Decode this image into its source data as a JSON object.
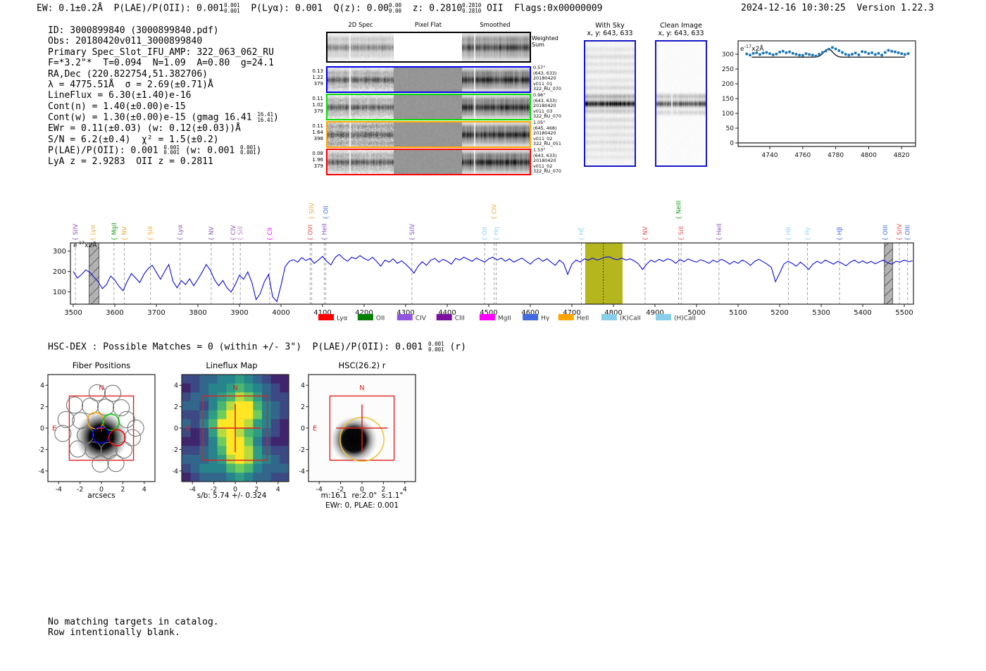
{
  "header": {
    "left_segments": [
      {
        "t": "EW: 0.1±0.2Å  P(LAE)/P(OII): 0.001"
      },
      {
        "f": [
          "0.001",
          "0.001"
        ]
      },
      {
        "t": "  P(Lyα): 0.001  Q(z): 0.00"
      },
      {
        "f": [
          "0.00",
          "0.00"
        ]
      },
      {
        "t": "  z: 0.2810"
      },
      {
        "f": [
          "0.2810",
          "0.2810"
        ]
      },
      {
        "t": " OII  Flags:0x00000009"
      }
    ],
    "right": "2024-12-16 10:30:25  Version 1.22.3"
  },
  "info_lines": [
    [
      {
        "t": "ID: 3000899840 (3000899840.pdf)"
      }
    ],
    [
      {
        "t": "Obs: 20180420v011_3000899840"
      }
    ],
    [
      {
        "t": "Primary Spec_Slot_IFU_AMP: 322_063_062_RU"
      }
    ],
    [
      {
        "t": "F=*3.2\"*  T=0.094  N=1.09  A=0.80  g=24.1"
      }
    ],
    [
      {
        "t": "RA,Dec (220.822754,51.382706)"
      }
    ],
    [
      {
        "t": "λ = 4775.51Å  σ = 2.69(±0.71)Å"
      }
    ],
    [
      {
        "t": "LineFlux = 6.30(±1.40)e-16"
      }
    ],
    [
      {
        "t": "Cont(n) = 1.40(±0.00)e-15"
      }
    ],
    [
      {
        "t": "Cont(w) = 1.30(±0.00)e-15 (gmag 16.41 "
      },
      {
        "f": [
          "16.41",
          "16.41"
        ]
      },
      {
        "t": ")"
      }
    ],
    [
      {
        "t": "EWr = 0.11(±0.03) (w: 0.12(±0.03))Å"
      }
    ],
    [
      {
        "t": "S/N = 6.2(±0.4)  χ² = 1.5(±0.2)"
      }
    ],
    [
      {
        "t": "P(LAE)/P(OII): 0.001 "
      },
      {
        "f": [
          "0.001",
          "0.001"
        ]
      },
      {
        "t": " (w: 0.001 "
      },
      {
        "f": [
          "0.001",
          "0.001"
        ]
      },
      {
        "t": ")"
      }
    ],
    [
      {
        "t": "LyA z = 2.9283  OII z = 0.2811"
      }
    ]
  ],
  "spec2d": {
    "col_headers": [
      "2D Spec",
      "Pixel Flat",
      "Smoothed"
    ],
    "weighted_label": [
      "Weighted",
      "Sum"
    ],
    "rows": [
      {
        "color": "#0000ee",
        "left": [
          "0.13",
          "1.22",
          "379"
        ],
        "right": [
          "0.57\"",
          "(643, 633)",
          "20180420",
          "v011_01",
          "322_RU_070"
        ]
      },
      {
        "color": "#00dd00",
        "left": [
          "0.11",
          "1.02",
          "379"
        ],
        "right": [
          "0.96\"",
          "(643, 633)",
          "20180420",
          "v011_03",
          "322_RU_070"
        ]
      },
      {
        "color": "#ffa500",
        "left": [
          "0.11",
          "1.64",
          "398"
        ],
        "right": [
          "1.05\"",
          "(645, 468)",
          "20180420",
          "v011_02",
          "322_RU_051"
        ]
      },
      {
        "color": "#ff0000",
        "left": [
          "0.08",
          "1.96",
          "379"
        ],
        "right": [
          "1.53\"",
          "(643, 633)",
          "20180420",
          "v011_02",
          "322_RU_070"
        ]
      }
    ]
  },
  "cutouts": {
    "with_sky": {
      "title": "With Sky",
      "subtitle": "x, y: 643, 633"
    },
    "clean": {
      "title": "Clean Image",
      "subtitle": "x, y: 643, 633"
    }
  },
  "hsc_dex_segments": [
    {
      "t": "HSC-DEX : Possible Matches = 0 (within +/- 3\")  P(LAE)/P(OII): 0.001 "
    },
    {
      "f": [
        "0.001",
        "0.001"
      ]
    },
    {
      "t": " (r)"
    }
  ],
  "footer_lines": [
    "No matching targets in catalog.",
    "Row intentionally blank."
  ],
  "chart_data": [
    {
      "id": "line_fit_zoom",
      "type": "scatter",
      "annotation": {
        "base": "e",
        "sup": "-17",
        "rest": "x2Å"
      },
      "xlim": [
        4720,
        4828
      ],
      "ylim": [
        -12,
        345
      ],
      "xticks": [
        4740,
        4760,
        4780,
        4800,
        4820
      ],
      "yticks": [
        0,
        50,
        100,
        150,
        200,
        250,
        300
      ],
      "point_color": "#1f77b4",
      "x_start": 4726,
      "x_step": 2,
      "y": [
        301,
        297,
        303,
        305,
        299,
        304,
        306,
        302,
        298,
        301,
        307,
        310,
        305,
        308,
        303,
        300,
        297,
        296,
        302,
        299,
        297,
        294,
        300,
        306,
        311,
        317,
        323,
        318,
        312,
        306,
        300,
        297,
        300,
        304,
        298,
        309,
        307,
        302,
        305,
        299,
        303,
        297,
        306,
        313,
        310,
        308,
        305,
        302,
        299,
        302
      ],
      "fit": {
        "baseline": 290,
        "amplitude": 28,
        "center": 4775.5,
        "sigma": 2.69
      }
    },
    {
      "id": "full_spectrum",
      "type": "line",
      "annotation": {
        "base": "e",
        "sup": "-17",
        "rest": "x2Å"
      },
      "xlim": [
        3493,
        5522
      ],
      "ylim": [
        40,
        340
      ],
      "xticks": [
        3500,
        3600,
        3700,
        3800,
        3900,
        4000,
        4100,
        4200,
        4300,
        4400,
        4500,
        4600,
        4700,
        4800,
        4900,
        5000,
        5100,
        5200,
        5300,
        5400,
        5500
      ],
      "yticks": [
        100,
        200,
        300
      ],
      "line_color": "#0b0bd6",
      "detection_wl": 4775.5,
      "highlight_band": [
        4732,
        4822
      ],
      "highlight_color": "#b5b51e",
      "hatch_bands": [
        [
          3538,
          3562
        ],
        [
          5452,
          5472
        ]
      ],
      "x_start": 3500,
      "x_step": 10,
      "y": [
        200,
        168,
        185,
        208,
        196,
        172,
        150,
        116,
        136,
        178,
        158,
        128,
        106,
        152,
        190,
        168,
        146,
        186,
        214,
        230,
        196,
        162,
        200,
        234,
        152,
        120,
        156,
        136,
        164,
        130,
        162,
        196,
        234,
        206,
        160,
        130,
        156,
        120,
        100,
        136,
        182,
        162,
        198,
        146,
        62,
        92,
        150,
        186,
        76,
        52,
        132,
        224,
        250,
        258,
        246,
        268,
        254,
        264,
        240,
        256,
        274,
        250,
        232,
        268,
        284,
        264,
        250,
        270,
        262,
        278,
        264,
        254,
        270,
        250,
        226,
        256,
        246,
        262,
        240,
        252,
        236,
        216,
        192,
        226,
        248,
        230,
        254,
        264,
        246,
        260,
        250,
        236,
        264,
        256,
        270,
        260,
        250,
        266,
        256,
        246,
        262,
        270,
        256,
        266,
        250,
        262,
        246,
        256,
        266,
        250,
        236,
        256,
        266,
        250,
        262,
        246,
        230,
        256,
        240,
        186,
        236,
        256,
        246,
        262,
        256,
        266,
        256,
        262,
        270,
        272,
        262,
        258,
        266,
        256,
        262,
        252,
        238,
        210,
        236,
        256,
        246,
        260,
        250,
        262,
        256,
        240,
        258,
        248,
        262,
        252,
        246,
        258,
        250,
        240,
        256,
        246,
        260,
        250,
        236,
        250,
        240,
        256,
        246,
        230,
        250,
        260,
        248,
        236,
        220,
        150,
        192,
        236,
        250,
        240,
        226,
        246,
        230,
        210,
        236,
        250,
        240,
        256,
        246,
        236,
        250,
        240,
        228,
        246,
        256,
        242,
        252,
        240,
        250,
        238,
        248,
        256,
        242,
        236,
        250,
        246,
        256,
        248,
        252
      ],
      "line_labels": [
        {
          "wl": 3505,
          "text": "SiIV",
          "color": "#8950b8",
          "tier": 0,
          "brace": "{"
        },
        {
          "wl": 3547,
          "text": "Lyα",
          "color": "#e8a838",
          "tier": 0,
          "brace": "{"
        },
        {
          "wl": 3598,
          "text": "MgII",
          "color": "#1a9e1a",
          "tier": 0,
          "brace": "{"
        },
        {
          "wl": 3623,
          "text": "NV",
          "color": "#e8a838",
          "tier": 0,
          "brace": "{"
        },
        {
          "wl": 3686,
          "text": "SiII",
          "color": "#e8a838",
          "tier": 0,
          "brace": "{"
        },
        {
          "wl": 3757,
          "text": "Lyα",
          "color": "#8950b8",
          "tier": 0,
          "brace": "{"
        },
        {
          "wl": 3832,
          "text": "NV",
          "color": "#8950b8",
          "tier": 0,
          "brace": "{"
        },
        {
          "wl": 3885,
          "text": "CIV",
          "color": "#8950b8",
          "tier": 0,
          "brace": "{"
        },
        {
          "wl": 3902,
          "text": "SiII",
          "color": "#c083d6",
          "tier": 0,
          "brace": "{"
        },
        {
          "wl": 3973,
          "text": "CII",
          "color": "#ff00ff",
          "tier": 0,
          "brace": "{"
        },
        {
          "wl": 4070,
          "text": "OVI",
          "color": "#e04a4a",
          "tier": 0,
          "brace": "{"
        },
        {
          "wl": 4074,
          "text": "SiIV",
          "color": "#e8a838",
          "tier": 1,
          "brace": "}"
        },
        {
          "wl": 4104,
          "text": "HeII",
          "color": "#8950b8",
          "tier": 0,
          "brace": "{"
        },
        {
          "wl": 4108,
          "text": "OII",
          "color": "#4169e1",
          "tier": 1,
          "brace": "{"
        },
        {
          "wl": 4315,
          "text": "SiIV",
          "color": "#8950b8",
          "tier": 0,
          "brace": "{"
        },
        {
          "wl": 4490,
          "text": "OII",
          "color": "#8fd0ea",
          "tier": 0,
          "brace": "{"
        },
        {
          "wl": 4513,
          "text": "CIV",
          "color": "#e8a838",
          "tier": 1,
          "brace": "{"
        },
        {
          "wl": 4518,
          "text": "Hη",
          "color": "#8fd0ea",
          "tier": 0,
          "brace": "{"
        },
        {
          "wl": 4723,
          "text": "Hζ",
          "color": "#8fd0ea",
          "tier": 0,
          "brace": "{"
        },
        {
          "wl": 4876,
          "text": "NV",
          "color": "#e04a4a",
          "tier": 0,
          "brace": "{"
        },
        {
          "wl": 4957,
          "text": "NeIII",
          "color": "#1a9e1a",
          "tier": 1,
          "brace": "{"
        },
        {
          "wl": 4963,
          "text": "SiII",
          "color": "#e04a4a",
          "tier": 0,
          "brace": "{"
        },
        {
          "wl": 5054,
          "text": "HeII",
          "color": "#8950b8",
          "tier": 0,
          "brace": "{"
        },
        {
          "wl": 5221,
          "text": "Hδ",
          "color": "#8fd0ea",
          "tier": 0,
          "brace": "{"
        },
        {
          "wl": 5267,
          "text": "Hγ",
          "color": "#8fd0ea",
          "tier": 0,
          "brace": "{"
        },
        {
          "wl": 5344,
          "text": "Hβ",
          "color": "#4169e1",
          "tier": 0,
          "brace": "{"
        },
        {
          "wl": 5454,
          "text": "OIII",
          "color": "#4169e1",
          "tier": 0,
          "brace": "{"
        },
        {
          "wl": 5488,
          "text": "SiIV",
          "color": "#e04a4a",
          "tier": 0,
          "brace": "{"
        },
        {
          "wl": 5508,
          "text": "OIII",
          "color": "#4169e1",
          "tier": 0,
          "brace": "{"
        }
      ],
      "legend": [
        {
          "label": "Lyα",
          "color": "#ff0000"
        },
        {
          "label": "OII",
          "color": "#008000"
        },
        {
          "label": "CIV",
          "color": "#9254de"
        },
        {
          "label": "CIII",
          "color": "#7a0fa0"
        },
        {
          "label": "MgII",
          "color": "#ff00ff"
        },
        {
          "label": "Hγ",
          "color": "#4169e1"
        },
        {
          "label": "HeII",
          "color": "#ffa500"
        },
        {
          "label": "(K)CaII",
          "color": "#87ceeb"
        },
        {
          "label": "(H)CaII",
          "color": "#87ceeb"
        }
      ]
    },
    {
      "id": "fiber_positions",
      "type": "scatter",
      "title": "Fiber Positions",
      "xlabel": "arcsecs",
      "n_label": "N",
      "e_label": "E",
      "ticks": [
        -4,
        -2,
        0,
        2,
        4
      ],
      "xlim": [
        -5,
        5
      ],
      "ylim": [
        -5,
        5
      ],
      "aperture_square": [
        -3,
        3
      ],
      "fiber_radius": 0.76,
      "source": {
        "x": 0.0,
        "y": -0.85
      },
      "fibers_gray": [
        [
          -0.4,
          3.3
        ],
        [
          1.05,
          3.25
        ],
        [
          -2.5,
          2.15
        ],
        [
          -1.05,
          2.05
        ],
        [
          0.4,
          1.95
        ],
        [
          1.85,
          1.9
        ],
        [
          -3.3,
          0.8
        ],
        [
          -1.95,
          0.7
        ],
        [
          2.35,
          0.8
        ],
        [
          3.2,
          0.0
        ],
        [
          -3.6,
          -0.5
        ],
        [
          -1.5,
          -0.65
        ],
        [
          2.9,
          -0.9
        ],
        [
          -2.2,
          -1.95
        ],
        [
          -0.75,
          -2.05
        ],
        [
          0.7,
          -2.1
        ],
        [
          2.1,
          -2.05
        ],
        [
          -0.1,
          -3.35
        ],
        [
          1.35,
          -3.3
        ]
      ],
      "fibers_colored": [
        {
          "x": -0.55,
          "y": 0.7,
          "color": "#ffa500"
        },
        {
          "x": 0.9,
          "y": 0.55,
          "color": "#00cc00"
        },
        {
          "x": -0.05,
          "y": -0.65,
          "color": "#0000ee"
        },
        {
          "x": 1.45,
          "y": -0.9,
          "color": "#ee0000"
        }
      ]
    },
    {
      "id": "lineflux_map",
      "type": "heatmap",
      "title": "Lineflux Map",
      "xlabel": "s/b: 5.74 +/- 0.324",
      "n_label": "N",
      "e_label": "E",
      "ticks": [
        -4,
        -2,
        0,
        2,
        4
      ],
      "xlim": [
        -5,
        5
      ],
      "ylim": [
        -5,
        5
      ],
      "aperture_square": [
        -3,
        3
      ],
      "matrix": [
        [
          2,
          2,
          3,
          3,
          4,
          4,
          5,
          4,
          3,
          2,
          1,
          1
        ],
        [
          1,
          2,
          3,
          4,
          4,
          5,
          6,
          5,
          4,
          3,
          2,
          1
        ],
        [
          2,
          3,
          3,
          4,
          5,
          6,
          8,
          7,
          5,
          3,
          2,
          2
        ],
        [
          3,
          3,
          2,
          4,
          6,
          8,
          9,
          9,
          6,
          4,
          3,
          2
        ],
        [
          2,
          2,
          3,
          5,
          7,
          9,
          9,
          9,
          7,
          4,
          3,
          2
        ],
        [
          3,
          2,
          4,
          6,
          9,
          9,
          9,
          8,
          5,
          4,
          2,
          1
        ],
        [
          2,
          1,
          2,
          5,
          8,
          9,
          8,
          6,
          5,
          3,
          2,
          1
        ],
        [
          1,
          1,
          2,
          4,
          7,
          9,
          9,
          7,
          4,
          2,
          1,
          1
        ],
        [
          2,
          2,
          3,
          4,
          6,
          9,
          9,
          8,
          5,
          3,
          2,
          2
        ],
        [
          3,
          3,
          3,
          4,
          5,
          8,
          9,
          8,
          5,
          4,
          3,
          2
        ],
        [
          2,
          3,
          4,
          4,
          4,
          6,
          7,
          6,
          4,
          3,
          3,
          3
        ],
        [
          1,
          2,
          3,
          3,
          3,
          4,
          5,
          4,
          3,
          3,
          2,
          2
        ]
      ]
    },
    {
      "id": "hsc_cutout",
      "type": "image",
      "title": "HSC(26.2) r",
      "xlabel1": "m:16.1  re:2.0\"  s:1.1\"",
      "xlabel2": "EWr: 0, PLAE: 0.001",
      "n_label": "N",
      "e_label": "E",
      "ticks": [
        -4,
        -2,
        0,
        2,
        4
      ],
      "xlim": [
        -5,
        5
      ],
      "ylim": [
        -5,
        5
      ],
      "aperture_square": [
        -3,
        3
      ],
      "source": {
        "x": -0.75,
        "y": -1.1
      },
      "aperture_circle": {
        "x": 0.0,
        "y": -1.05,
        "r": 2.05,
        "color": "#f0c33c"
      }
    }
  ]
}
